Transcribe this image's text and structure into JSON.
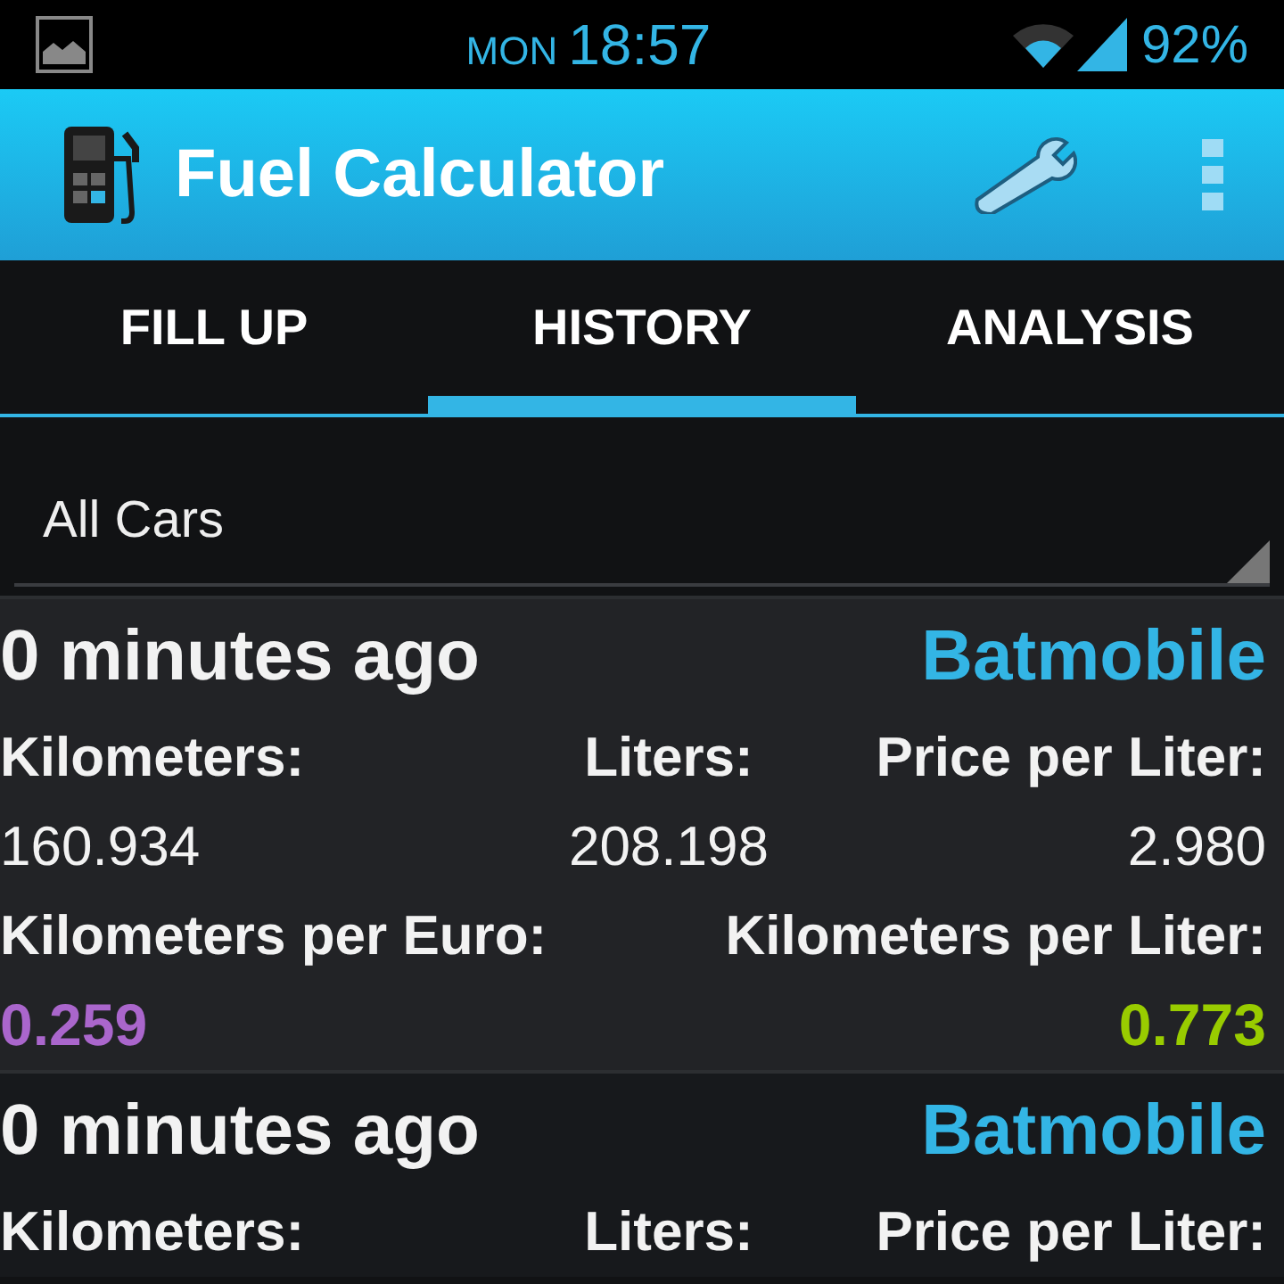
{
  "status_bar": {
    "day": "MON",
    "time": "18:57",
    "battery": "92%"
  },
  "action_bar": {
    "title": "Fuel Calculator"
  },
  "tabs": [
    {
      "label": "FILL UP",
      "selected": false
    },
    {
      "label": "HISTORY",
      "selected": true
    },
    {
      "label": "ANALYSIS",
      "selected": false
    }
  ],
  "car_filter": {
    "value": "All Cars"
  },
  "entries": [
    {
      "time": "0 minutes ago",
      "car": "Batmobile",
      "fields": [
        {
          "label": "Kilometers:",
          "value": "160.934"
        },
        {
          "label": "Liters:",
          "value": "208.198"
        },
        {
          "label": "Price per Liter:",
          "value": "2.980"
        }
      ],
      "stats": [
        {
          "label": "Kilometers per Euro:",
          "value": "0.259",
          "color": "#aa66cc"
        },
        {
          "label": "Kilometers per Liter:",
          "value": "0.773",
          "color": "#99cc00"
        }
      ]
    },
    {
      "time": "0 minutes ago",
      "car": "Batmobile",
      "fields": [
        {
          "label": "Kilometers:"
        },
        {
          "label": "Liters:"
        },
        {
          "label": "Price per Liter:"
        }
      ]
    }
  ]
}
